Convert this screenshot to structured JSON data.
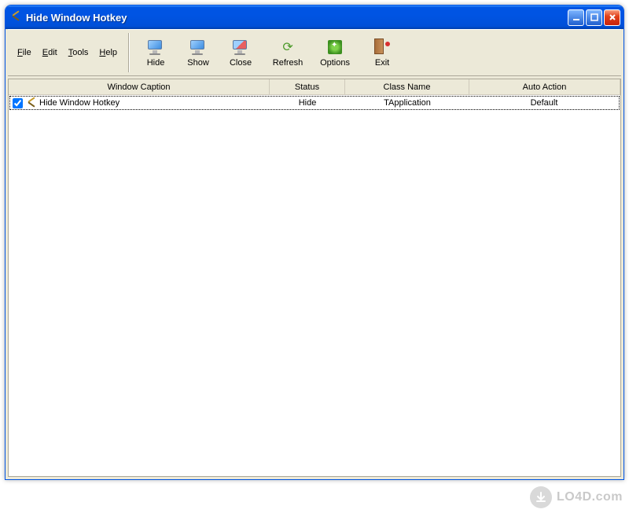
{
  "window": {
    "title": "Hide Window Hotkey"
  },
  "menu": {
    "file": "File",
    "edit": "Edit",
    "tools": "Tools",
    "help": "Help"
  },
  "toolbar": {
    "hide": "Hide",
    "show": "Show",
    "close": "Close",
    "refresh": "Refresh",
    "options": "Options",
    "exit": "Exit"
  },
  "columns": {
    "caption": "Window Caption",
    "status": "Status",
    "class": "Class Name",
    "action": "Auto Action"
  },
  "rows": [
    {
      "checked": true,
      "caption": "Hide Window Hotkey",
      "status": "Hide",
      "class": "TApplication",
      "action": "Default"
    }
  ],
  "watermark": "LO4D.com"
}
